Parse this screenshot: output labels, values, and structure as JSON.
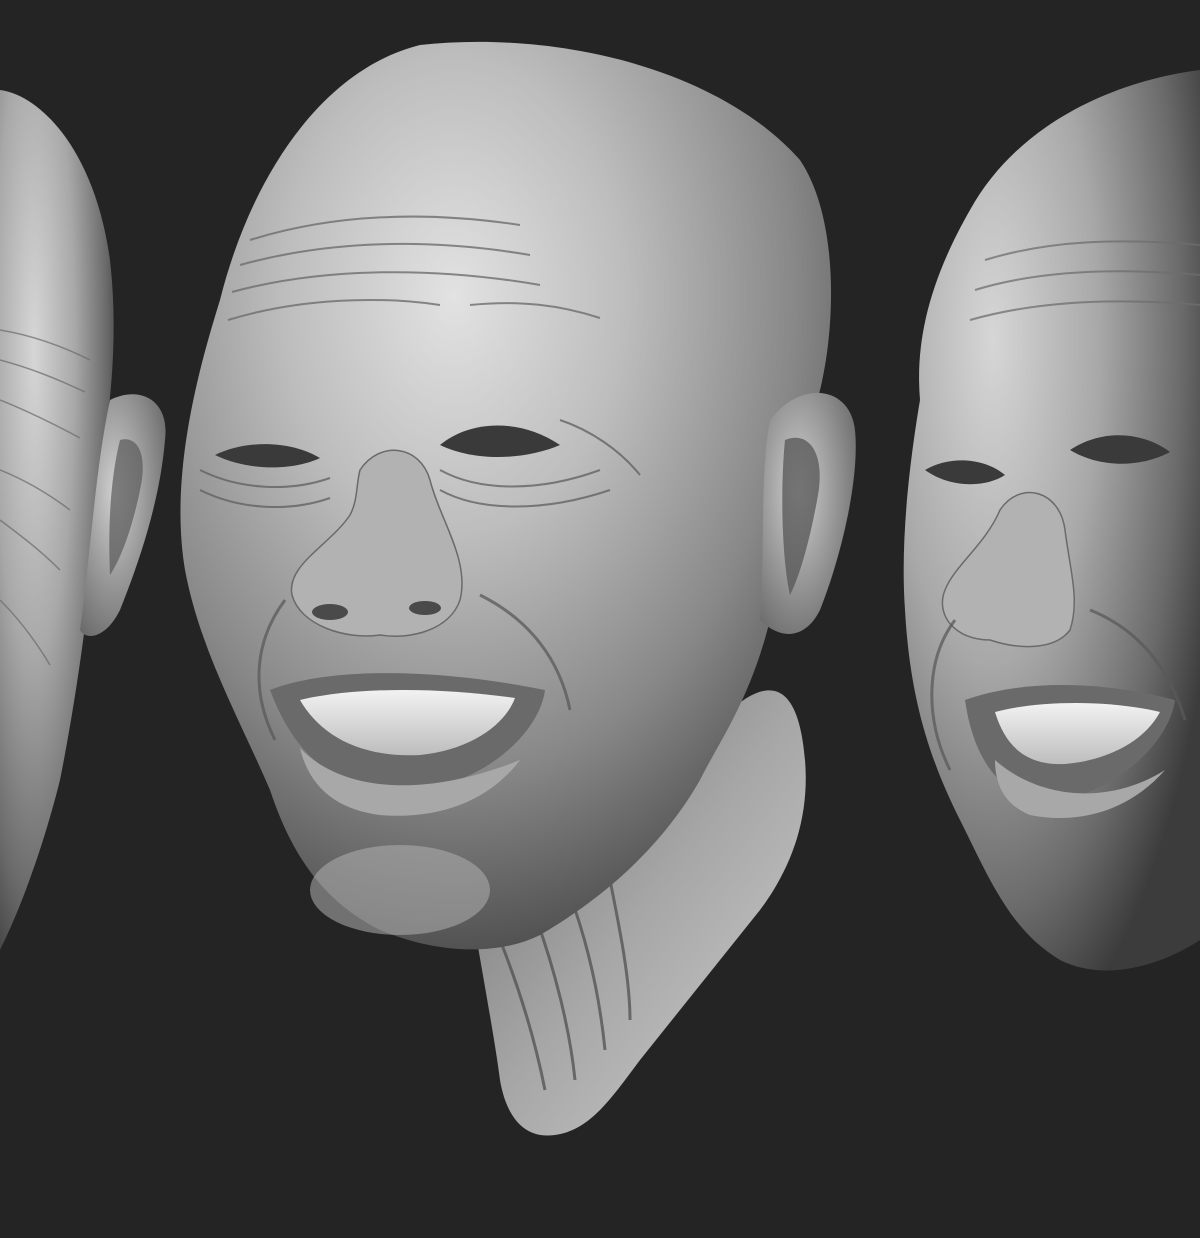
{
  "scene": {
    "background_color": "#242424",
    "material_color": "#9a9a9a",
    "highlight_color": "#e6e6e6",
    "shadow_color": "#3a3a3a",
    "views": [
      {
        "name": "left-view",
        "description_visible": false
      },
      {
        "name": "center-view",
        "description_visible": false
      },
      {
        "name": "right-view",
        "description_visible": false
      }
    ]
  }
}
